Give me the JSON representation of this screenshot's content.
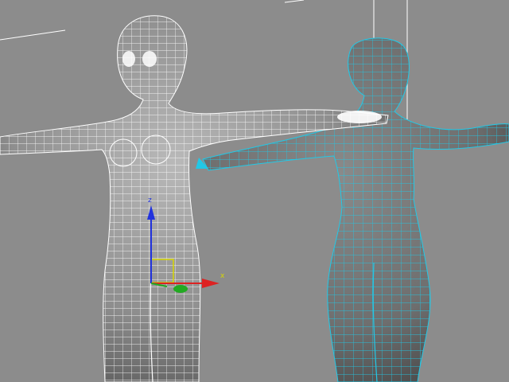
{
  "viewport": {
    "background_color": "#8c8c8c",
    "objects": [
      {
        "name": "character-front",
        "wire_color": "#ffffff",
        "selected": false
      },
      {
        "name": "character-back",
        "wire_color": "#22c8e6",
        "selected": false
      }
    ]
  },
  "gizmo": {
    "x_label": "x",
    "z_label": "z",
    "x_color": "#dd2222",
    "y_color": "#22aa22",
    "z_color": "#2233dd",
    "plane_color": "#d7d700"
  }
}
